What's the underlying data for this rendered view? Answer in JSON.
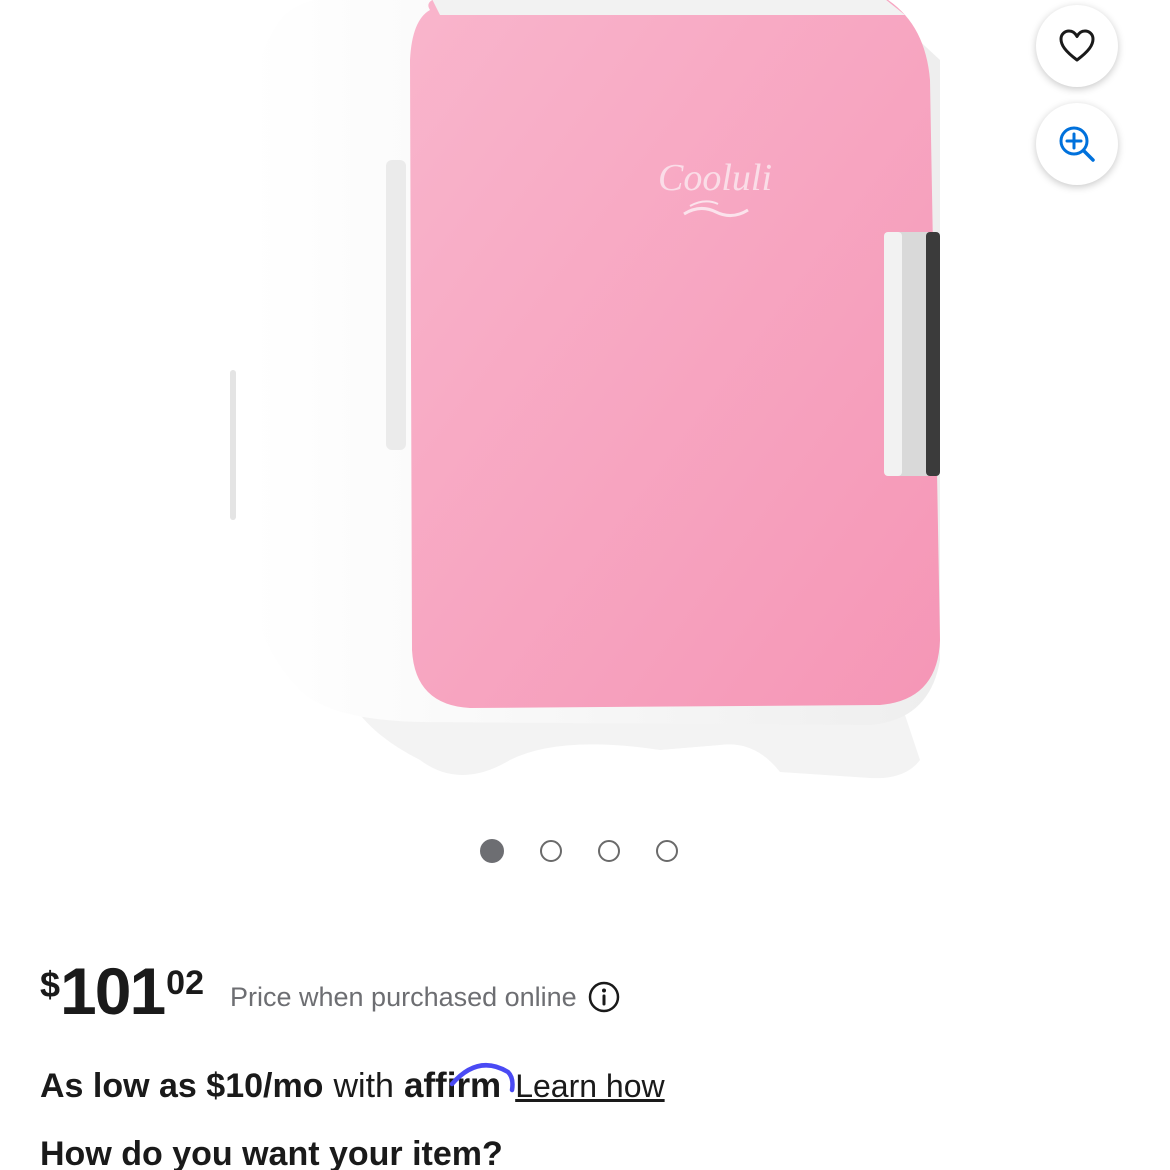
{
  "gallery": {
    "brand_on_product": "Cooluli",
    "image_count": 4,
    "active_index": 0,
    "colors": {
      "fridge_door": "#f7a3bf",
      "fridge_body": "#f5f5f5",
      "handle": "#dcdcdc",
      "dot_active": "#6d6e72",
      "zoom_icon": "#0071dc"
    }
  },
  "icons": {
    "favorite": "heart-icon",
    "zoom": "zoom-in-icon",
    "info": "info-icon"
  },
  "price": {
    "currency": "$",
    "dollars": "101",
    "cents": "02",
    "note": "Price when purchased online"
  },
  "financing": {
    "prefix": "As low as $10/mo",
    "with_text": "with",
    "provider": "affirm",
    "link": "Learn how"
  },
  "fulfillment": {
    "heading": "How do you want your item?"
  }
}
